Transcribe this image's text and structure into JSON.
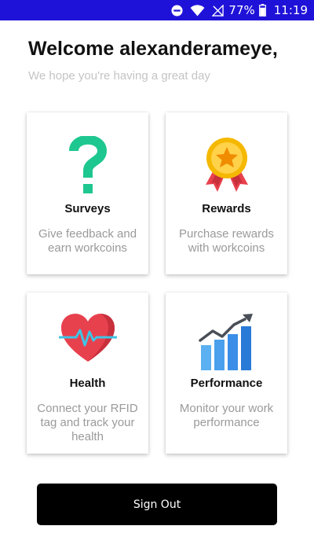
{
  "status_bar": {
    "battery_percent": "77%",
    "time": "11:19",
    "background_color": "#1f12d8",
    "icons": [
      "do-not-disturb-icon",
      "wifi-icon",
      "no-signal-icon",
      "battery-icon"
    ]
  },
  "header": {
    "title": "Welcome alexanderameye,",
    "subtitle": "We hope you're having a great day"
  },
  "cards": [
    {
      "title": "Surveys",
      "description": "Give feedback and earn workcoins",
      "icon": "question-mark-icon",
      "icon_color": "#1ec78f"
    },
    {
      "title": "Rewards",
      "description": "Purchase rewards with workcoins",
      "icon": "medal-icon",
      "icon_color": "#f5b800"
    },
    {
      "title": "Health",
      "description": "Connect your RFID tag and track your health",
      "icon": "heartbeat-icon",
      "icon_color": "#e8414e"
    },
    {
      "title": "Performance",
      "description": "Monitor your work performance",
      "icon": "bar-chart-growth-icon",
      "icon_color": "#3a8ee8"
    }
  ],
  "sign_out": {
    "label": "Sign Out"
  }
}
